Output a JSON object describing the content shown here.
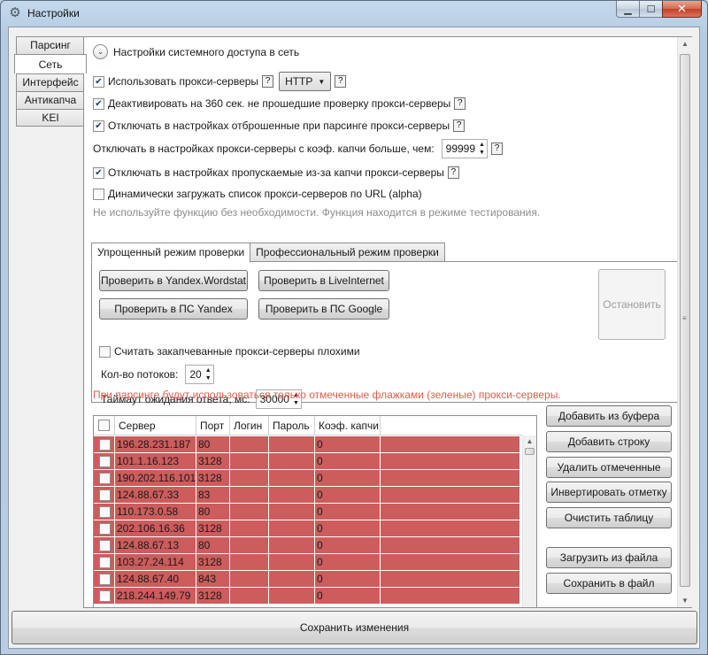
{
  "window": {
    "title": "Настройки"
  },
  "left_tabs": [
    "Парсинг",
    "Сеть",
    "Интерфейс",
    "Антикапча",
    "KEI"
  ],
  "section": {
    "title": "Настройки системного доступа в сеть"
  },
  "options": {
    "use_proxy": {
      "label": "Использовать прокси-серверы",
      "checked": true,
      "help": "?"
    },
    "proxy_type": {
      "value": "HTTP"
    },
    "deactivate": {
      "label": "Деактивировать на 360 сек. не прошедшие проверку прокси-серверы",
      "checked": true,
      "help": "?"
    },
    "disable_rejected": {
      "label": "Отключать в настройках отброшенные при парсинге прокси-серверы",
      "checked": true,
      "help": "?"
    },
    "captcha_ratio": {
      "label": "Отключать в настройках прокси-серверы с коэф. капчи больше, чем:",
      "value": "99999",
      "help": "?"
    },
    "disable_captcha_skipped": {
      "label": "Отключать в настройках пропускаемые из-за капчи прокси-серверы",
      "checked": true,
      "help": "?"
    },
    "dynamic_load": {
      "label": "Динамически загружать список прокси-серверов по URL (alpha)",
      "checked": false
    },
    "dynamic_note": "Не используйте функцию без необходимости. Функция находится в режиме тестирования."
  },
  "check_tabs": [
    "Упрощенный режим проверки",
    "Профессиональный режим проверки"
  ],
  "check": {
    "btn_yandex_wordstat": "Проверить в Yandex.Wordstat",
    "btn_liveinternet": "Проверить в LiveInternet",
    "btn_ps_yandex": "Проверить в ПС Yandex",
    "btn_ps_google": "Проверить в ПС Google",
    "btn_stop": "Остановить",
    "bad_captcha": {
      "label": "Считать закапчеванные прокси-серверы плохими",
      "checked": false
    },
    "threads_label": "Кол-во потоков:",
    "threads_value": "20",
    "timeout_label": "Таймаут ожидания ответа, мс:",
    "timeout_value": "30000"
  },
  "warning_text": "При парсинге будут использоваться только отмеченные флажками (зеленые) прокси-серверы.",
  "table": {
    "columns": [
      "Сервер",
      "Порт",
      "Логин",
      "Пароль",
      "Коэф. капчи"
    ],
    "row_color": "#cd5c5c",
    "rows": [
      {
        "server": "196.28.231.187",
        "port": "80",
        "login": "",
        "password": "",
        "captcha": "0"
      },
      {
        "server": "101.1.16.123",
        "port": "3128",
        "login": "",
        "password": "",
        "captcha": "0"
      },
      {
        "server": "190.202.116.101",
        "port": "3128",
        "login": "",
        "password": "",
        "captcha": "0"
      },
      {
        "server": "124.88.67.33",
        "port": "83",
        "login": "",
        "password": "",
        "captcha": "0"
      },
      {
        "server": "110.173.0.58",
        "port": "80",
        "login": "",
        "password": "",
        "captcha": "0"
      },
      {
        "server": "202.106.16.36",
        "port": "3128",
        "login": "",
        "password": "",
        "captcha": "0"
      },
      {
        "server": "124.88.67.13",
        "port": "80",
        "login": "",
        "password": "",
        "captcha": "0"
      },
      {
        "server": "103.27.24.114",
        "port": "3128",
        "login": "",
        "password": "",
        "captcha": "0"
      },
      {
        "server": "124.88.67.40",
        "port": "843",
        "login": "",
        "password": "",
        "captcha": "0"
      },
      {
        "server": "218.244.149.79",
        "port": "3128",
        "login": "",
        "password": "",
        "captcha": "0"
      }
    ]
  },
  "side_buttons": {
    "add_clipboard": "Добавить из буфера",
    "add_row": "Добавить строку",
    "delete_checked": "Удалить отмеченные",
    "invert": "Инвертировать отметку",
    "clear": "Очистить таблицу",
    "load_file": "Загрузить из файла",
    "save_file": "Сохранить в файл"
  },
  "footer": {
    "save_label": "Сохранить изменения"
  }
}
